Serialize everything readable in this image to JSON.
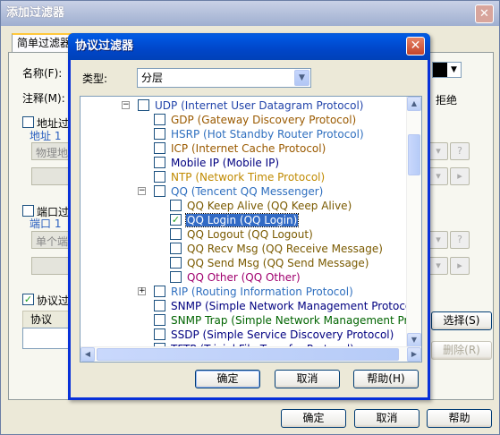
{
  "outer": {
    "title": "添加过滤器",
    "tab_label": "简单过滤器",
    "name_label": "名称(F):",
    "comment_label": "注释(M):",
    "deny_label": "拒绝",
    "address_filter_label": "地址过",
    "address_group_label": "地址 1",
    "address_field": "物理地",
    "port_filter_label": "端口过",
    "port_group_label": "端口 1",
    "port_field": "单个端",
    "protocol_filter_label": "协议过",
    "protocol_header": "协议",
    "select_button": "选择(S)",
    "delete_button": "删除(R)",
    "help_glyph": "?",
    "ok_button": "确定",
    "cancel_button": "取消",
    "help_button": "帮助"
  },
  "dialog": {
    "title": "协议过滤器",
    "type_label": "类型:",
    "type_value": "分层",
    "ok_button": "确定",
    "cancel_button": "取消",
    "help_button": "帮助(H)"
  },
  "tree": [
    {
      "label": "UDP (Internet User Datagram Protocol)",
      "color": "#2244aa",
      "checked": false
    },
    {
      "label": "GDP (Gateway Discovery Protocol)",
      "color": "#9a5a00",
      "checked": false
    },
    {
      "label": "HSRP (Hot Standby Router Protocol)",
      "color": "#2f6fbf",
      "checked": false
    },
    {
      "label": "ICP (Internet Cache Protocol)",
      "color": "#9a5a00",
      "checked": false
    },
    {
      "label": "Mobile IP (Mobile IP)",
      "color": "#000080",
      "checked": false
    },
    {
      "label": "NTP (Network Time Protocol)",
      "color": "#c08a00",
      "checked": false
    },
    {
      "label": "QQ (Tencent QQ Messenger)",
      "color": "#2f6fbf",
      "checked": false
    },
    {
      "label": "QQ Keep Alive (QQ Keep Alive)",
      "color": "#7a5a00",
      "checked": false
    },
    {
      "label": "QQ Login (QQ Login)",
      "color": "#ffffff",
      "checked": true
    },
    {
      "label": "QQ Logout (QQ Logout)",
      "color": "#7a5a00",
      "checked": false
    },
    {
      "label": "QQ Recv Msg (QQ Receive Message)",
      "color": "#7a5a00",
      "checked": false
    },
    {
      "label": "QQ Send Msg (QQ Send Message)",
      "color": "#7a5a00",
      "checked": false
    },
    {
      "label": "QQ Other (QQ Other)",
      "color": "#a0006e",
      "checked": false
    },
    {
      "label": "RIP (Routing Information Protocol)",
      "color": "#2f6fbf",
      "checked": false
    },
    {
      "label": "SNMP (Simple Network Management Protocol)",
      "color": "#000080",
      "checked": false
    },
    {
      "label": "SNMP Trap (Simple Network Management Protocol - Tra",
      "color": "#006400",
      "checked": false
    },
    {
      "label": "SSDP (Simple Service Discovery Protocol)",
      "color": "#000080",
      "checked": false
    },
    {
      "label": "TFTP (Trivial File Transfer Protocol)",
      "color": "#000080",
      "checked": false
    }
  ],
  "icons": {
    "close": "close-icon",
    "combo_arrow": "chevron-down-icon",
    "check": "checkmark-icon",
    "expand": "plus-icon",
    "collapse": "minus-icon"
  }
}
